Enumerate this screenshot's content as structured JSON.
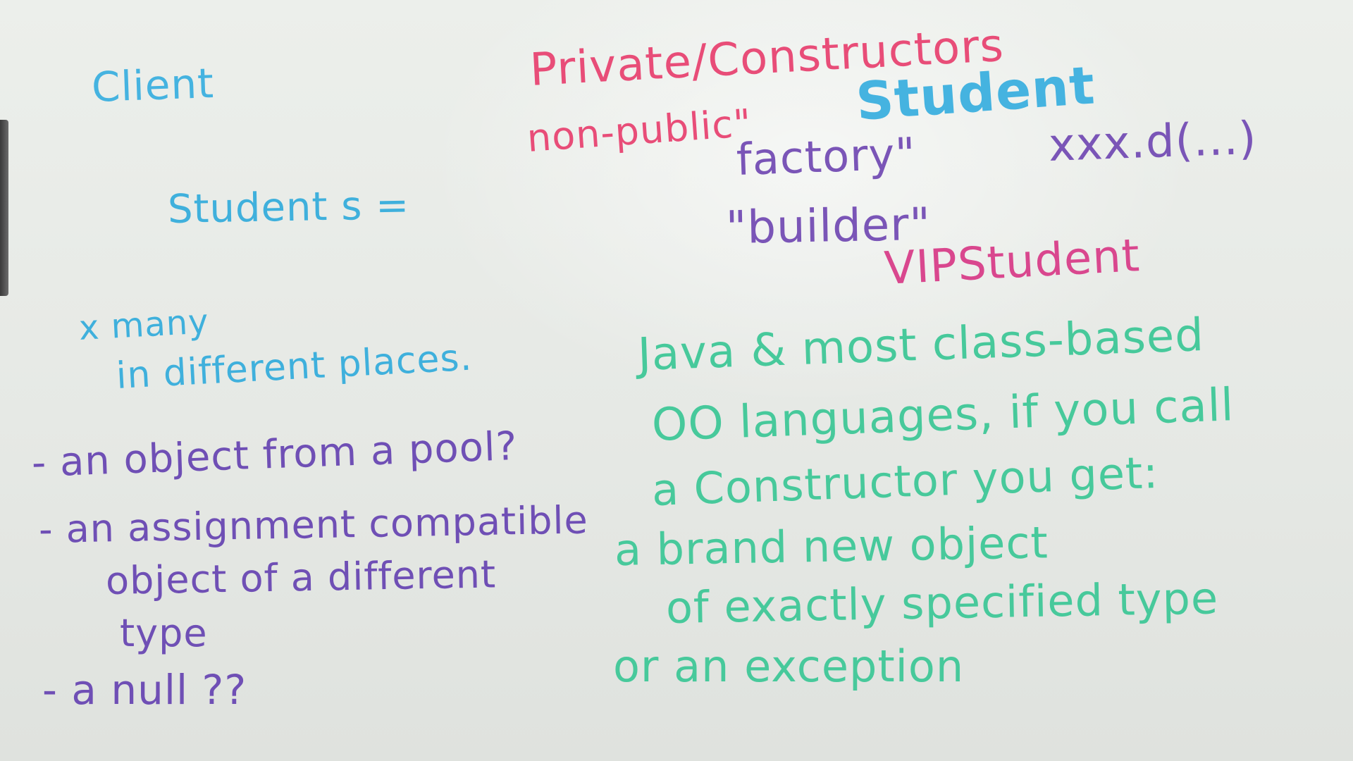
{
  "left": {
    "client": "Client",
    "student_s": "Student s =",
    "many_1": "x many",
    "many_2": "in different places.",
    "item_pool": "- an object from a pool?",
    "item_assign": "- an assignment compatible",
    "item_assign_2": "object of a different",
    "item_assign_3": "type",
    "item_null": "- a null ??"
  },
  "right": {
    "private_constructors": "Private/Constructors",
    "non_public": "non-public\"",
    "student": "Student",
    "xxx_call": "xxx.d(...)",
    "factory": "factory\"",
    "builder": "\"builder\"",
    "vip_student": "VIPStudent"
  },
  "green_note": {
    "line1": "Java & most class-based",
    "line2": "OO languages, if you call",
    "line3": "a Constructor you get:",
    "line4": "a brand new object",
    "line5": "of exactly specified type",
    "line6": "or an exception"
  },
  "colors": {
    "board": "#e9ece8",
    "cyan_marker": "#45b3e0",
    "pink_marker": "#e84d78",
    "purple_marker": "#7a55b7",
    "green_marker": "#47c99b"
  }
}
